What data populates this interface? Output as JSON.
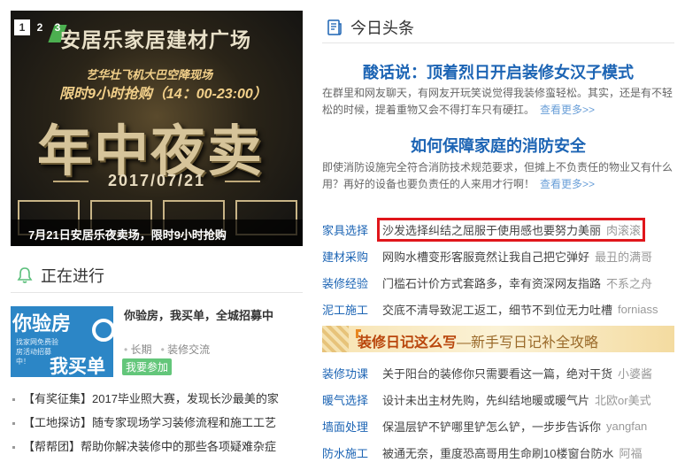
{
  "banner": {
    "slide_numbers": [
      "1",
      "2",
      "3"
    ],
    "brand": "安居乐家居建材广场",
    "sub1": "艺华壮飞机大巴空降现场",
    "sub2": "限时9小时抢购（14：00-23:00）",
    "headline": "年中夜卖",
    "date": "2017/07/21",
    "caption": "7月21日安居乐夜卖场，限时9小时抢购"
  },
  "ongoing": {
    "title": "正在进行",
    "promo": {
      "img_line1": "你验房",
      "img_line2": "找家网免费验房活动招募中！",
      "img_line3": "我买单",
      "title": "你验房，我买单，全城招募中",
      "meta_city": "长期",
      "meta_type": "装修交流",
      "tag": "我要参加"
    },
    "items": [
      "【有奖征集】2017毕业照大赛，发现长沙最美的家",
      "【工地探访】随专家现场学习装修流程和施工工艺",
      "【帮帮团】帮助你解决装修中的那些各项疑难杂症"
    ]
  },
  "today": {
    "title": "今日头条",
    "headlines": [
      {
        "title": "酸话说：顶着烈日开启装修女汉子模式",
        "desc": "在群里和网友聊天，有网友开玩笑说觉得我装修蛮轻松。其实，还是有不轻松的时候，提着重物又会不得打车只有硬扛。",
        "more": "查看更多>>"
      },
      {
        "title": "如何保障家庭的消防安全",
        "desc": "即使消防设施完全符合消防技术规范要求，但摊上不负责任的物业又有什么用？再好的设备也要负责任的人来用才行啊！",
        "more": "查看更多>>"
      }
    ],
    "rows_top": [
      {
        "cat": "家具选择",
        "text": "沙发选择纠结之屈服于使用感也要努力美丽",
        "author": "肉滚滚"
      },
      {
        "cat": "建材采购",
        "text": "网购水槽变形客服竟然让我自己把它弹好",
        "author": "最丑的满哥"
      },
      {
        "cat": "装修经验",
        "text": "门槛石计价方式套路多，幸有资深网友指路",
        "author": "不系之舟"
      },
      {
        "cat": "泥工施工",
        "text": "交底不清导致泥工返工，细节不到位无力吐槽",
        "author": "forniass"
      }
    ],
    "diary_banner": {
      "strong": "装修日记这么写",
      "rest": "—新手写日记补全攻略"
    },
    "rows_bottom": [
      {
        "cat": "装修功课",
        "text": "关于阳台的装修你只需要看这一篇，绝对干货",
        "author": "小婆酱"
      },
      {
        "cat": "暖气选择",
        "text": "设计未出主材先购，先纠结地暖或暖气片",
        "author": "北欧or美式"
      },
      {
        "cat": "墙面处理",
        "text": "保温层铲不铲哪里铲怎么铲，一步步告诉你",
        "author": "yangfan"
      },
      {
        "cat": "防水施工",
        "text": "被通无奈，重度恐高哥用生命刷10楼窗台防水",
        "author": "阿福"
      }
    ]
  },
  "colors": {
    "link_blue": "#1c64b4",
    "highlight_red": "#e0161b",
    "tag_green": "#63c67a"
  }
}
